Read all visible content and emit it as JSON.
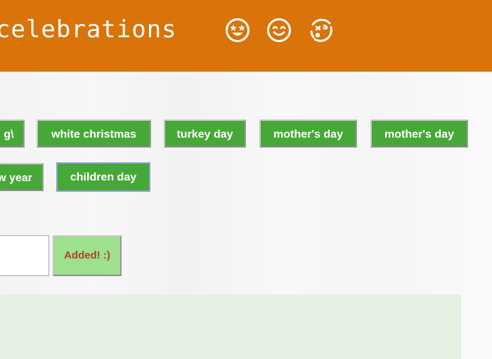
{
  "header": {
    "title": "celebrations",
    "emojis": [
      "star-struck-face-icon",
      "smiling-face-icon",
      "dizzy-face-icon"
    ],
    "background_color": "#d9730a"
  },
  "tags": {
    "row1": [
      "g\\",
      "white christmas",
      "turkey day",
      "mother's day",
      "mother's day"
    ],
    "row2": [
      "w year",
      "children day"
    ],
    "active": "children day",
    "button_color": "#46a837"
  },
  "add_form": {
    "input_value": "",
    "submit_label": "Added! :)",
    "submit_color": "#9de08e"
  }
}
